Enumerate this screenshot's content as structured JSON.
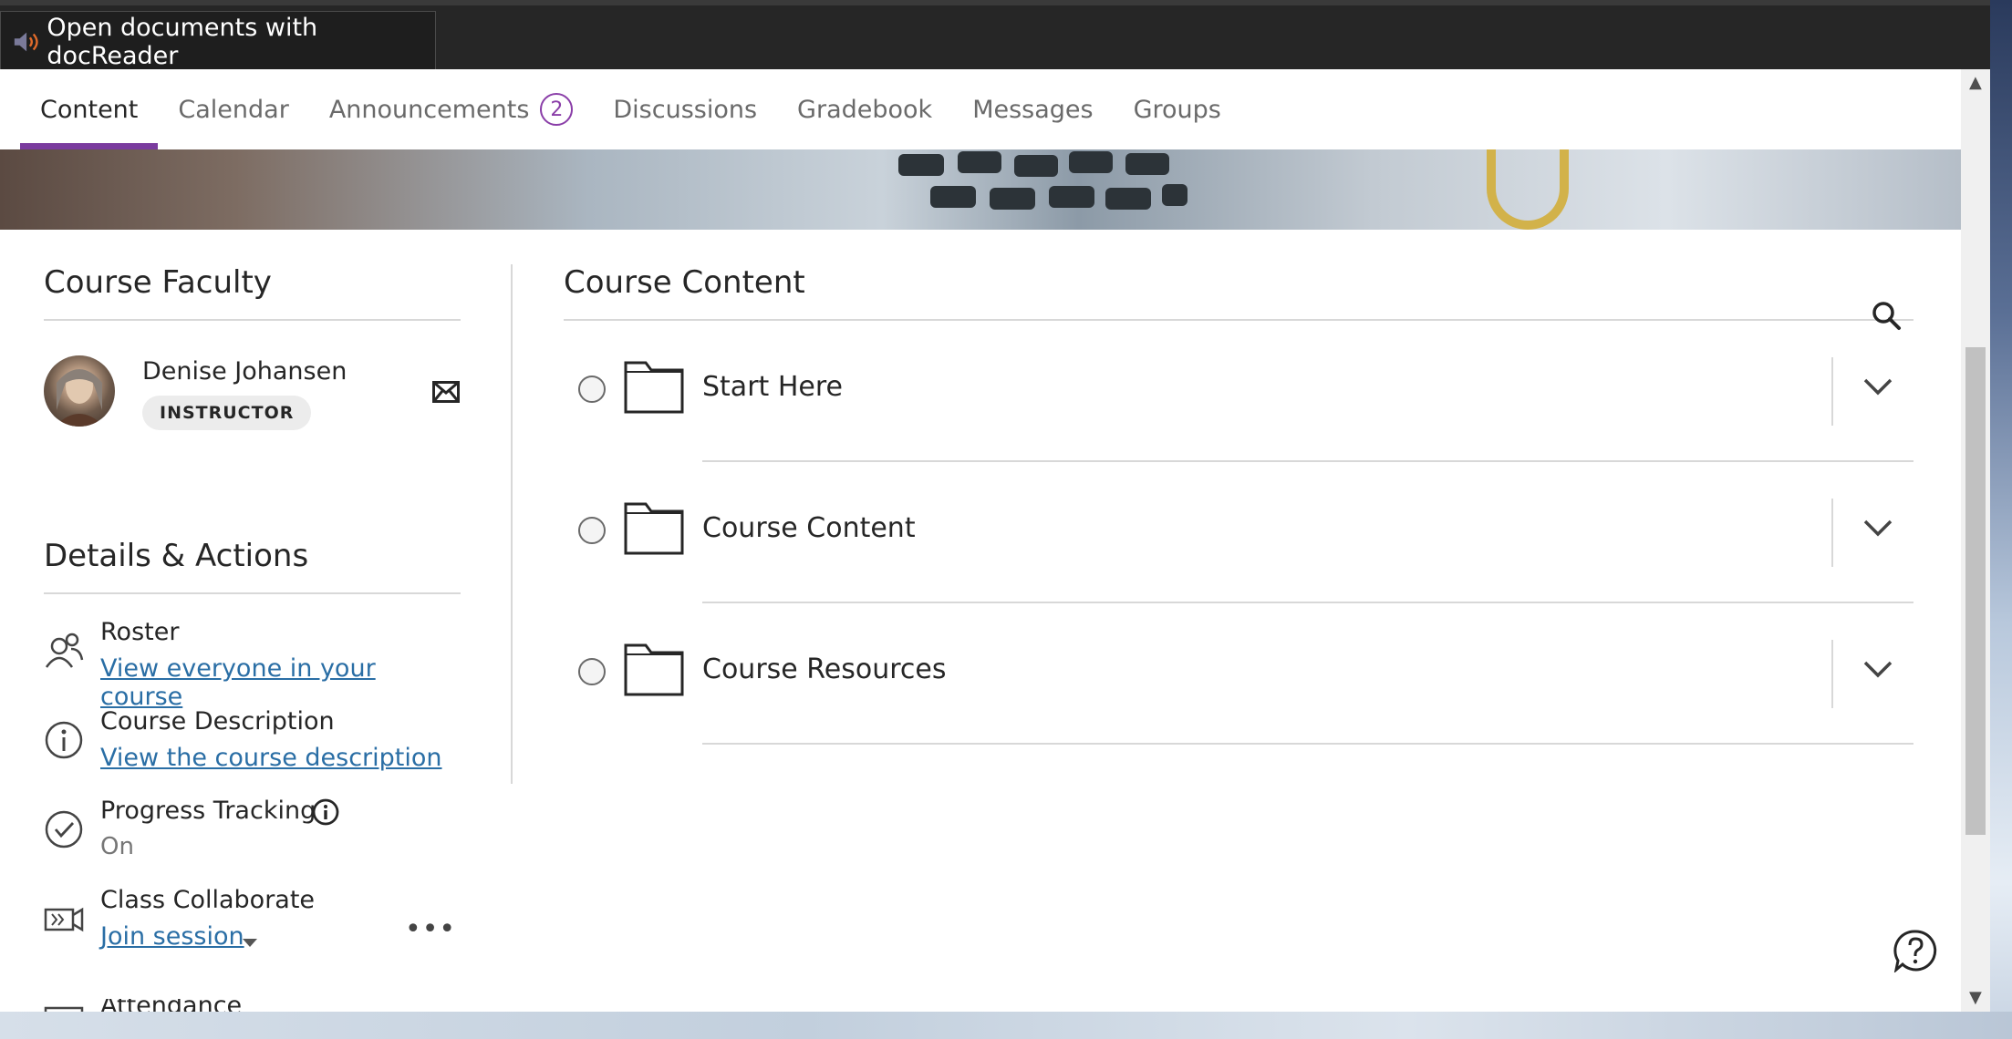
{
  "toolbar": {
    "docreader_label": "Open documents with docReader"
  },
  "tabs": [
    {
      "label": "Content",
      "active": true
    },
    {
      "label": "Calendar"
    },
    {
      "label": "Announcements",
      "badge": "2"
    },
    {
      "label": "Discussions"
    },
    {
      "label": "Gradebook"
    },
    {
      "label": "Messages"
    },
    {
      "label": "Groups"
    }
  ],
  "faculty": {
    "title": "Course Faculty",
    "name": "Denise Johansen",
    "role": "INSTRUCTOR"
  },
  "details": {
    "title": "Details & Actions",
    "items": [
      {
        "label": "Roster",
        "link": "View everyone in your course",
        "icon": "roster-icon"
      },
      {
        "label": "Course Description",
        "link": "View the course description",
        "icon": "info-circle-icon"
      },
      {
        "label": "Progress Tracking",
        "value": "On",
        "icon": "check-circle-icon"
      },
      {
        "label": "Class Collaborate",
        "link": "Join session",
        "icon": "video-icon"
      },
      {
        "label": "Attendance",
        "icon": "attendance-icon"
      }
    ]
  },
  "content": {
    "title": "Course Content",
    "folders": [
      {
        "title": "Start Here"
      },
      {
        "title": "Course Content"
      },
      {
        "title": "Course Resources"
      }
    ]
  },
  "colors": {
    "accent": "#7a3b9e",
    "link": "#2a6ea5",
    "topbar": "#262626"
  }
}
